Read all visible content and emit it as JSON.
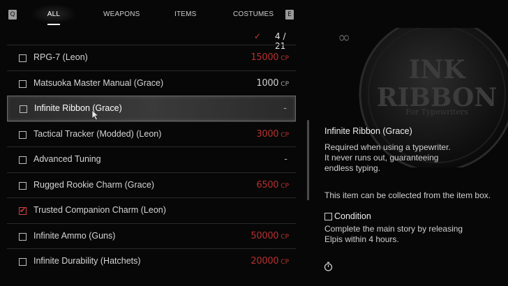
{
  "tabs": {
    "left_key": "Q",
    "right_key": "E",
    "items": [
      {
        "label": "ALL",
        "active": true
      },
      {
        "label": "WEAPONS",
        "active": false
      },
      {
        "label": "ITEMS",
        "active": false
      },
      {
        "label": "COSTUMES",
        "active": false
      }
    ]
  },
  "counter": {
    "check_icon": "checkmark-icon",
    "value": "4 / 21"
  },
  "list": {
    "rows": [
      {
        "name": "RPG-7 (Leon)",
        "checked": false,
        "price": "15000",
        "unit": "CP",
        "price_color": "#b8302f"
      },
      {
        "name": "Matsuoka Master Manual (Grace)",
        "checked": false,
        "price": "1000",
        "unit": "CP",
        "price_color": "#d0d0d0"
      },
      {
        "name": "Infinite Ribbon (Grace)",
        "checked": false,
        "price": "-",
        "unit": "",
        "selected": true
      },
      {
        "name": "Tactical Tracker (Modded) (Leon)",
        "checked": false,
        "price": "3000",
        "unit": "CP",
        "price_color": "#b8302f"
      },
      {
        "name": "Advanced Tuning",
        "checked": false,
        "price": "-",
        "unit": ""
      },
      {
        "name": "Rugged Rookie Charm (Grace)",
        "checked": false,
        "price": "6500",
        "unit": "CP",
        "price_color": "#b8302f"
      },
      {
        "name": "Trusted Companion Charm (Leon)",
        "checked": true,
        "price": "",
        "unit": ""
      },
      {
        "name": "Infinite Ammo (Guns)",
        "checked": false,
        "price": "50000",
        "unit": "CP",
        "price_color": "#b8302f"
      },
      {
        "name": "Infinite Durability (Hatchets)",
        "checked": false,
        "price": "20000",
        "unit": "CP",
        "price_color": "#b8302f"
      }
    ]
  },
  "detail": {
    "emblem": {
      "line1": "INK",
      "line2": "RIBBON",
      "line3": "For Typewriters"
    },
    "infinity_icon": "∞",
    "title": "Infinite Ribbon (Grace)",
    "description": [
      "Required when using a typewriter.",
      "It never runs out, guaranteeing",
      "endless typing."
    ],
    "note": "This item can be collected from the item box.",
    "condition_label": "Condition",
    "condition_checked": false,
    "condition_text": [
      "Complete the main story by releasing",
      "Elpis within 4 hours."
    ],
    "timer_icon": "stopwatch-icon"
  }
}
